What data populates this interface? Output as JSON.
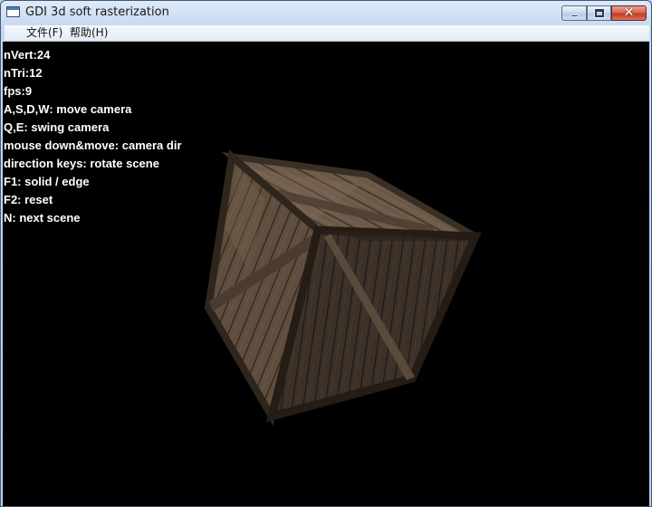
{
  "window": {
    "title": "GDI 3d soft rasterization",
    "controls": {
      "minimize_icon": "minimize-icon",
      "maximize_icon": "maximize-icon",
      "close_glyph": "✕"
    }
  },
  "menu": {
    "items": [
      {
        "label": "文件(F)"
      },
      {
        "label": "帮助(H)"
      }
    ]
  },
  "hud": {
    "lines": [
      "nVert:24",
      "nTri:12",
      "fps:9",
      "A,S,D,W: move camera",
      "Q,E: swing camera",
      "mouse down&move: camera dir",
      "direction keys: rotate scene",
      "F1: solid / edge",
      "F2: reset",
      "N: next scene"
    ]
  },
  "scene": {
    "object": "textured wooden crate (cube)",
    "background_color": "#000000",
    "wood_color": "#6b5a48"
  }
}
